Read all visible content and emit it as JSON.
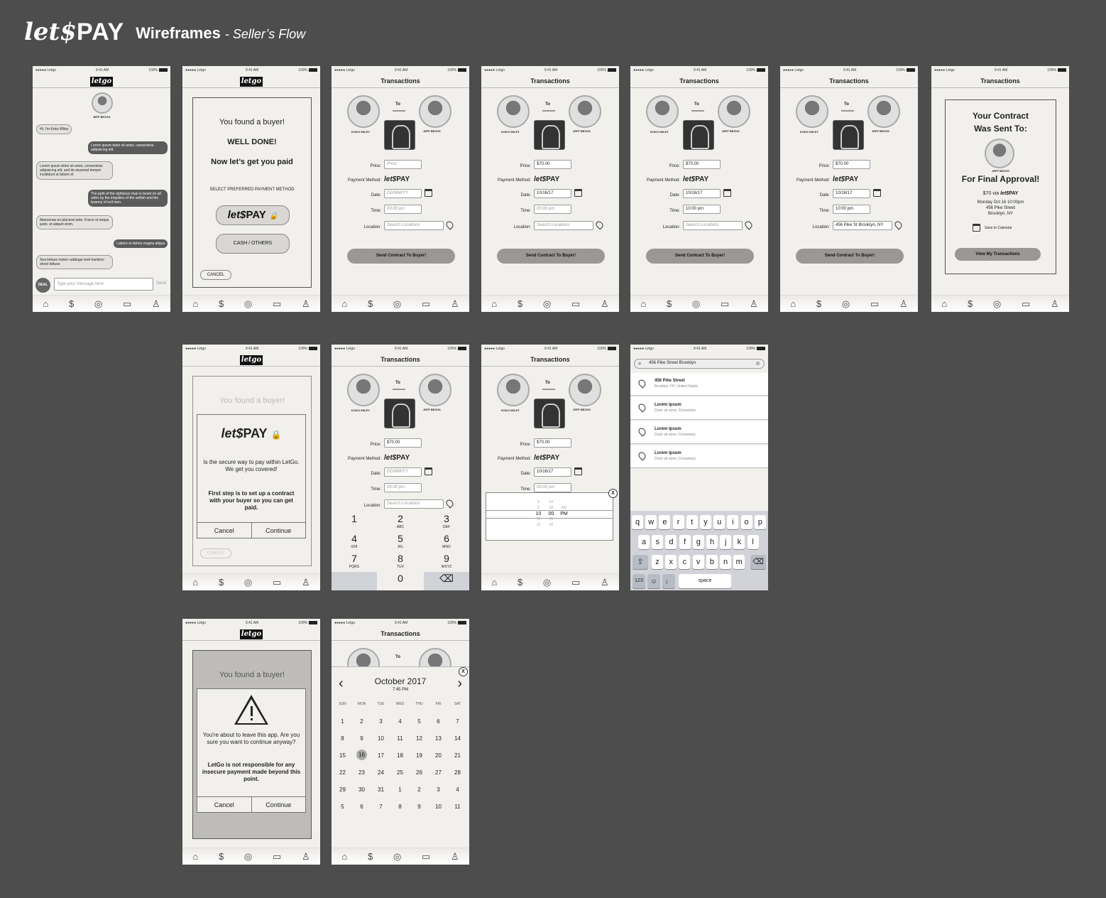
{
  "header": {
    "brand_let": "let",
    "brand_dollar": "$",
    "brand_pay": "PAY",
    "title": "Wireframes",
    "subtitle": "- Seller’s Flow"
  },
  "status": {
    "carrier": "●●●●● Letgo",
    "time": "9:41 AM",
    "battery": "100%"
  },
  "nav": {
    "transactions": "Transactions",
    "letgo_logo": "letgo"
  },
  "tabbar_icons": [
    "home-icon",
    "dollar-icon",
    "camera-icon",
    "chat-icon",
    "profile-icon"
  ],
  "tabbar_glyphs": [
    "⌂",
    "$",
    "◎",
    "▭",
    "♙"
  ],
  "chat": {
    "contact": "JEFF BEZOS",
    "messages": [
      {
        "side": "l",
        "text": "Hi, I'm Koko Wiley"
      },
      {
        "side": "r",
        "text": "Lorem ipsum dolor sit amet, consectetur adipisicing elit."
      },
      {
        "side": "l",
        "text": "Lorem ipsum dolor sit amet, consectetur adipisicing elit, sed do eiusmod tempor incididunt ut labore et"
      },
      {
        "side": "r",
        "text": "The path of the righteous man is beset on all sides by the iniquities of the selfish and the tyranny of evil men."
      },
      {
        "side": "l",
        "text": "Maecenas eu placerat ante. Fusce ut neque justo, et aliquet enim."
      },
      {
        "side": "r",
        "text": "Labore et dolore magna aliqua"
      },
      {
        "side": "l",
        "text": "Sea lettuce melon cabbage leek bamboo shoot lettuce"
      }
    ],
    "deal_label": "DEAL",
    "input_placeholder": "Type your message here",
    "send_label": "Send"
  },
  "found": {
    "line1": "You found a buyer!",
    "line2": "WELL DONE!",
    "line3": "Now let’s get you paid",
    "select_method": "SELECT PREFERRED PAYMENT METHOD",
    "cash_label": "CASH / OTHERS",
    "cancel_label": "CANCEL"
  },
  "transaction": {
    "seller": "KOKO WILEY",
    "buyer": "JEFF BEZOS",
    "to_label": "To",
    "price_label": "Price:",
    "method_label": "Payment Method:",
    "date_label": "Date:",
    "time_label": "Time:",
    "location_label": "Location:",
    "price_placeholder": "Price",
    "date_placeholder": "DD/MM/YY",
    "time_placeholder": "00:00  pm",
    "location_placeholder": "Search Locations",
    "price_value": "$70.00",
    "date_value": "10/16/17",
    "time_value": "10:00 pm",
    "location_value": "456 Pike St Brooklyn, NY",
    "send_button": "Send Contract To Buyer!"
  },
  "sent": {
    "line1": "Your Contract",
    "line2": "Was Sent To:",
    "buyer": "JEFF BEZOS",
    "approval": "For Final Approval!",
    "amount": "$70 via",
    "datetime": "Monday Oct 16 10:00pm",
    "street": "456 Pike Street",
    "city": "Brooklyn, NY",
    "calendar": "Save to Calendar",
    "view_button": "View My Transactions"
  },
  "secure_dialog": {
    "body": "Is the secure way to pay within LetGo. We get you covered!",
    "body2": "First step is to set up a contract with your buyer so you can get paid.",
    "cancel": "Cancel",
    "continue": "Continue"
  },
  "numpad": [
    {
      "n": "1",
      "l": ""
    },
    {
      "n": "2",
      "l": "ABC"
    },
    {
      "n": "3",
      "l": "DEF"
    },
    {
      "n": "4",
      "l": "GHI"
    },
    {
      "n": "5",
      "l": "JKL"
    },
    {
      "n": "6",
      "l": "MNO"
    },
    {
      "n": "7",
      "l": "PQRS"
    },
    {
      "n": "8",
      "l": "TUV"
    },
    {
      "n": "9",
      "l": "WXYZ"
    },
    {
      "n": "",
      "l": ""
    },
    {
      "n": "0",
      "l": ""
    },
    {
      "n": "⌫",
      "l": ""
    }
  ],
  "time_picker": {
    "hours": [
      "8",
      "9",
      "10",
      "11",
      "12"
    ],
    "minutes": [
      "54",
      "58",
      "00",
      "01",
      "02"
    ],
    "ampm": [
      "",
      "AM",
      "PM",
      "",
      ""
    ],
    "close": "X"
  },
  "search": {
    "query": "456 Pike Street Brooklyn",
    "results": [
      {
        "title": "456 Pike Street",
        "sub": "Brooklyn, NY, United States"
      },
      {
        "title": "Lorem Ipsum",
        "sub": "Dolor sit amet, Consetetur"
      },
      {
        "title": "Lorem Ipsum",
        "sub": "Dolor sit amet, Consetetur"
      },
      {
        "title": "Lorem Ipsum",
        "sub": "Dolor sit amet, Consetetur"
      }
    ],
    "keys_row1": [
      "q",
      "w",
      "e",
      "r",
      "t",
      "y",
      "u",
      "i",
      "o",
      "p"
    ],
    "keys_row2": [
      "a",
      "s",
      "d",
      "f",
      "g",
      "h",
      "j",
      "k",
      "l"
    ],
    "keys_row3": [
      "z",
      "x",
      "c",
      "v",
      "b",
      "n",
      "m"
    ],
    "key_123": "123",
    "key_space": "space"
  },
  "leave_dialog": {
    "body": "You're about to leave this app. Are you sure you want to continue anyway?",
    "warn": "LetGo is not responsible for any insecure payment made beyond this point.",
    "cancel": "Cancel",
    "continue": "Continue"
  },
  "calendar": {
    "month": "October 2017",
    "time": "7:45 PM",
    "weekdays": [
      "SUN",
      "MON",
      "TUE",
      "WED",
      "THU",
      "FRI",
      "SAT"
    ],
    "days": [
      "1",
      "2",
      "3",
      "4",
      "5",
      "6",
      "7",
      "8",
      "9",
      "10",
      "11",
      "12",
      "13",
      "14",
      "15",
      "16",
      "17",
      "18",
      "19",
      "20",
      "21",
      "22",
      "23",
      "24",
      "25",
      "26",
      "27",
      "28",
      "29",
      "30",
      "31",
      "1",
      "2",
      "3",
      "4",
      "5",
      "6",
      "7",
      "8",
      "9",
      "10",
      "11"
    ],
    "selected": "16",
    "close": "X"
  }
}
